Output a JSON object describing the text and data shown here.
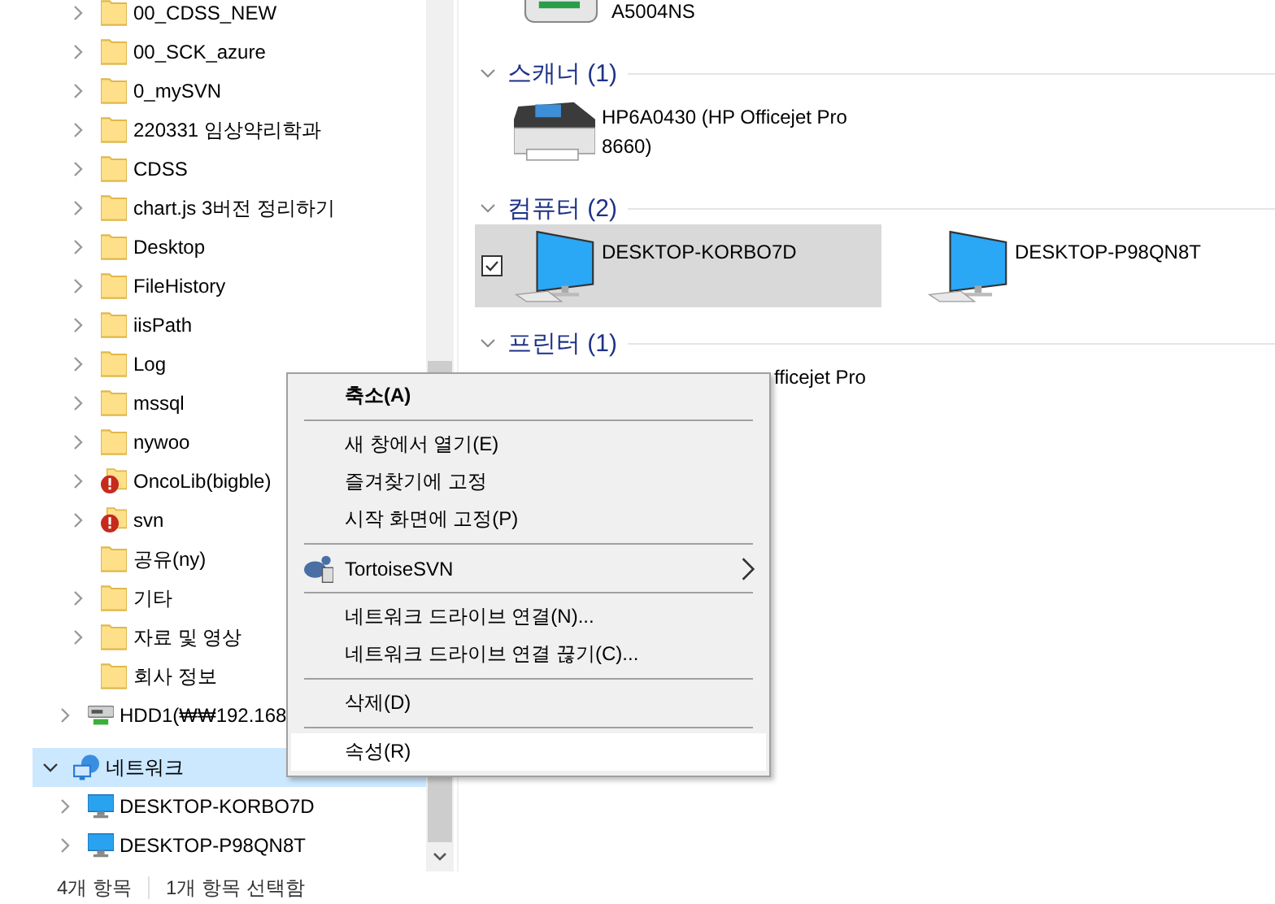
{
  "nav_tree": [
    {
      "children": [
        {
          "children": [
            {
              "label": "00_CDSS_NEW",
              "kind": "folder",
              "expandable": true,
              "selected": false
            },
            {
              "label": "00_SCK_azure",
              "kind": "folder",
              "expandable": true,
              "selected": false
            },
            {
              "label": "0_mySVN",
              "kind": "folder",
              "expandable": true,
              "selected": false
            },
            {
              "label": "220331 임상약리학과",
              "kind": "folder",
              "expandable": true,
              "selected": false
            },
            {
              "label": "CDSS",
              "kind": "folder",
              "expandable": true,
              "selected": false
            },
            {
              "label": "chart.js 3버전 정리하기",
              "kind": "folder",
              "expandable": true,
              "selected": false
            },
            {
              "label": "Desktop",
              "kind": "folder",
              "expandable": true,
              "selected": false
            },
            {
              "label": "FileHistory",
              "kind": "folder",
              "expandable": true,
              "selected": false
            },
            {
              "label": "iisPath",
              "kind": "folder",
              "expandable": true,
              "selected": false
            },
            {
              "label": "Log",
              "kind": "folder",
              "expandable": true,
              "selected": false
            },
            {
              "label": "mssql",
              "kind": "folder",
              "expandable": true,
              "selected": false
            },
            {
              "label": "nywoo",
              "kind": "folder",
              "expandable": true,
              "selected": false
            },
            {
              "label": "OncoLib(bigble)",
              "kind": "folder-error",
              "expandable": true,
              "selected": false
            },
            {
              "label": "svn",
              "kind": "folder-error",
              "expandable": true,
              "selected": false
            },
            {
              "label": "공유(ny)",
              "kind": "folder",
              "expandable": false,
              "selected": false
            },
            {
              "label": "기타",
              "kind": "folder",
              "expandable": true,
              "selected": false
            },
            {
              "label": "자료 및 영상",
              "kind": "folder",
              "expandable": true,
              "selected": false
            },
            {
              "label": "회사 정보",
              "kind": "folder",
              "expandable": false,
              "selected": false
            }
          ]
        },
        {
          "label": "HDD1(₩₩192.168",
          "kind": "drive",
          "expandable": true,
          "selected": false
        }
      ]
    },
    {
      "label": "네트워크",
      "kind": "network",
      "expandable": true,
      "expanded": true,
      "selected": true,
      "children": [
        {
          "label": "DESKTOP-KORBO7D",
          "kind": "computer",
          "expandable": true,
          "selected": false
        },
        {
          "label": "DESKTOP-P98QN8T",
          "kind": "computer",
          "expandable": true,
          "selected": false
        }
      ]
    }
  ],
  "content": {
    "top_item": {
      "label": "A5004NS",
      "kind": "router"
    },
    "groups": [
      {
        "title": "스캐너 (1)",
        "expanded": true,
        "items": [
          {
            "kind": "printer",
            "label": "HP6A0430 (HP Officejet Pro 8660)",
            "selected": false,
            "checked": false
          }
        ]
      },
      {
        "title": "컴퓨터 (2)",
        "expanded": true,
        "items": [
          {
            "kind": "computer",
            "label": "DESKTOP-KORBO7D",
            "selected": true,
            "checked": true
          },
          {
            "kind": "computer",
            "label": "DESKTOP-P98QN8T",
            "selected": false,
            "checked": false
          }
        ]
      },
      {
        "title": "프린터 (1)",
        "expanded": true,
        "items": [
          {
            "kind": "covered",
            "label": "fficejet Pro"
          }
        ]
      }
    ]
  },
  "context_menu": [
    {
      "kind": "item",
      "label": "축소(A)",
      "default": true,
      "selected": false
    },
    {
      "kind": "separator"
    },
    {
      "kind": "item",
      "label": "새 창에서 열기(E)",
      "default": false,
      "selected": false
    },
    {
      "kind": "item",
      "label": "즐겨찾기에 고정",
      "default": false,
      "selected": false
    },
    {
      "kind": "item",
      "label": "시작 화면에 고정(P)",
      "default": false,
      "selected": false
    },
    {
      "kind": "separator"
    },
    {
      "kind": "submenu",
      "label": "TortoiseSVN",
      "default": false,
      "selected": false
    },
    {
      "kind": "separator"
    },
    {
      "kind": "item",
      "label": "네트워크 드라이브 연결(N)...",
      "default": false,
      "selected": false
    },
    {
      "kind": "item",
      "label": "네트워크 드라이브 연결 끊기(C)...",
      "default": false,
      "selected": false
    },
    {
      "kind": "separator"
    },
    {
      "kind": "item",
      "label": "삭제(D)",
      "default": false,
      "selected": false
    },
    {
      "kind": "separator"
    },
    {
      "kind": "item",
      "label": "속성(R)",
      "default": false,
      "selected": true
    }
  ],
  "status_bar": [
    "4개 항목",
    "1개 항목 선택함"
  ]
}
